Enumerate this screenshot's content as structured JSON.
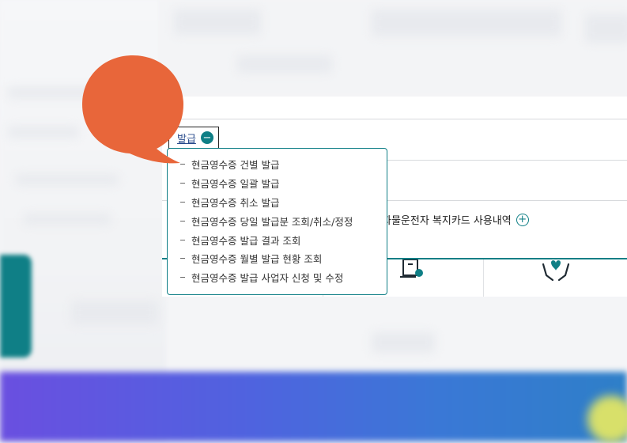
{
  "menu": {
    "link_label": "발급",
    "dropdown_items": [
      "현금영수증 건별 발급",
      "현금영수증 일괄 발급",
      "현금영수증 취소 발급",
      "현금영수증 당일 발급분 조회/취소/정정",
      "현금영수증 발급 결과 조회",
      "현금영수증 월별 발급 현황 조회",
      "현금영수증 발급 사업자 신청 및 수정"
    ]
  },
  "welfare": {
    "label": "화물운전자 복지카드 사용내역"
  },
  "icons": {
    "collapse": "minus-circle-icon",
    "expand": "plus-circle-icon",
    "bubble": "speech-bubble-icon",
    "certificate": "certificate-icon",
    "care": "hands-heart-icon"
  },
  "colors": {
    "accent": "#0f7f86",
    "bubble": "#e8663a",
    "link": "#2a4c8c"
  }
}
